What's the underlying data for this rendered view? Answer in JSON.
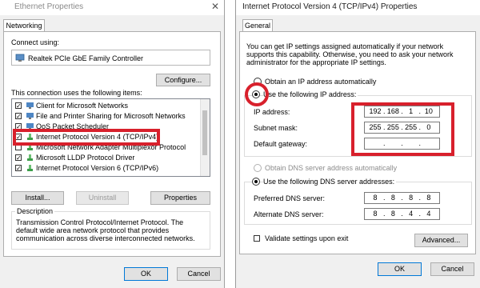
{
  "colors": {
    "annotation_red": "#d8202c",
    "dialog_bg": "#f0f0f0",
    "primary_border": "#0078d7"
  },
  "left_dialog": {
    "title": "Ethernet Properties",
    "tab": "Networking",
    "connect_using_label": "Connect using:",
    "adapter_name": "Realtek PCIe GbE Family Controller",
    "configure_button": "Configure...",
    "items_label": "This connection uses the following items:",
    "items": [
      {
        "label": "Client for Microsoft Networks",
        "checked": true,
        "icon": "network-client-icon"
      },
      {
        "label": "File and Printer Sharing for Microsoft Networks",
        "checked": true,
        "icon": "file-sharing-icon"
      },
      {
        "label": "QoS Packet Scheduler",
        "checked": true,
        "icon": "qos-icon"
      },
      {
        "label": "Internet Protocol Version 4 (TCP/IPv4)",
        "checked": true,
        "icon": "protocol-icon",
        "highlighted": true
      },
      {
        "label": "Microsoft Network Adapter Multiplexor Protocol",
        "checked": false,
        "icon": "protocol-icon"
      },
      {
        "label": "Microsoft LLDP Protocol Driver",
        "checked": true,
        "icon": "protocol-icon"
      },
      {
        "label": "Internet Protocol Version 6 (TCP/IPv6)",
        "checked": true,
        "icon": "protocol-icon"
      }
    ],
    "install_button": "Install...",
    "uninstall_button": "Uninstall",
    "properties_button": "Properties",
    "description_label": "Description",
    "description_text": "Transmission Control Protocol/Internet Protocol. The default wide area network protocol that provides communication across diverse interconnected networks.",
    "ok_button": "OK",
    "cancel_button": "Cancel"
  },
  "right_dialog": {
    "title": "Internet Protocol Version 4 (TCP/IPv4) Properties",
    "tab": "General",
    "intro_text": "You can get IP settings assigned automatically if your network supports this capability. Otherwise, you need to ask your network administrator for the appropriate IP settings.",
    "radio_auto_ip": "Obtain an IP address automatically",
    "radio_manual_ip": "Use the following IP address:",
    "ip_address_label": "IP address:",
    "ip_address": [
      "192",
      "168",
      "1",
      "10"
    ],
    "subnet_mask_label": "Subnet mask:",
    "subnet_mask": [
      "255",
      "255",
      "255",
      "0"
    ],
    "gateway_label": "Default gateway:",
    "gateway": [
      "",
      "",
      "",
      ""
    ],
    "radio_auto_dns": "Obtain DNS server address automatically",
    "radio_manual_dns": "Use the following DNS server addresses:",
    "preferred_dns_label": "Preferred DNS server:",
    "preferred_dns": [
      "8",
      "8",
      "8",
      "8"
    ],
    "alternate_dns_label": "Alternate DNS server:",
    "alternate_dns": [
      "8",
      "8",
      "4",
      "4"
    ],
    "validate_label": "Validate settings upon exit",
    "advanced_button": "Advanced...",
    "ok_button": "OK",
    "cancel_button": "Cancel"
  }
}
